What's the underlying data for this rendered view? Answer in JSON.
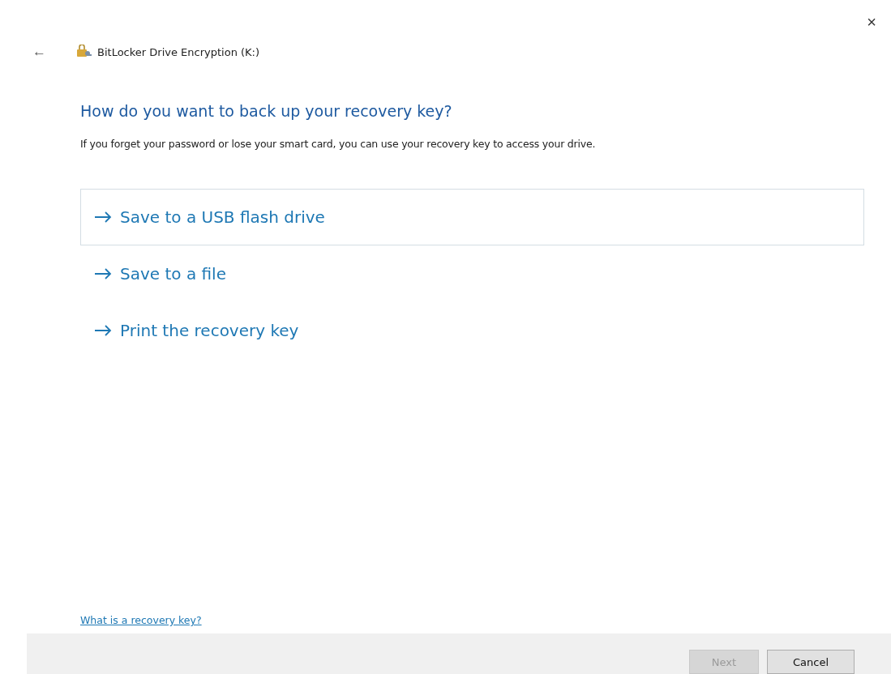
{
  "window": {
    "title": "BitLocker Drive Encryption (K:)",
    "close": "×",
    "back": "←"
  },
  "heading": "How do you want to back up your recovery key?",
  "description": "If you forget your password or lose your smart card, you can use your recovery key to access your drive.",
  "options": [
    {
      "label": "Save to a USB flash drive",
      "selected": true
    },
    {
      "label": "Save to a file",
      "selected": false
    },
    {
      "label": "Print the recovery key",
      "selected": false
    }
  ],
  "help_link": "What is a recovery key?",
  "buttons": [
    {
      "label": "Next",
      "disabled": true
    },
    {
      "label": "Cancel",
      "disabled": false
    }
  ]
}
